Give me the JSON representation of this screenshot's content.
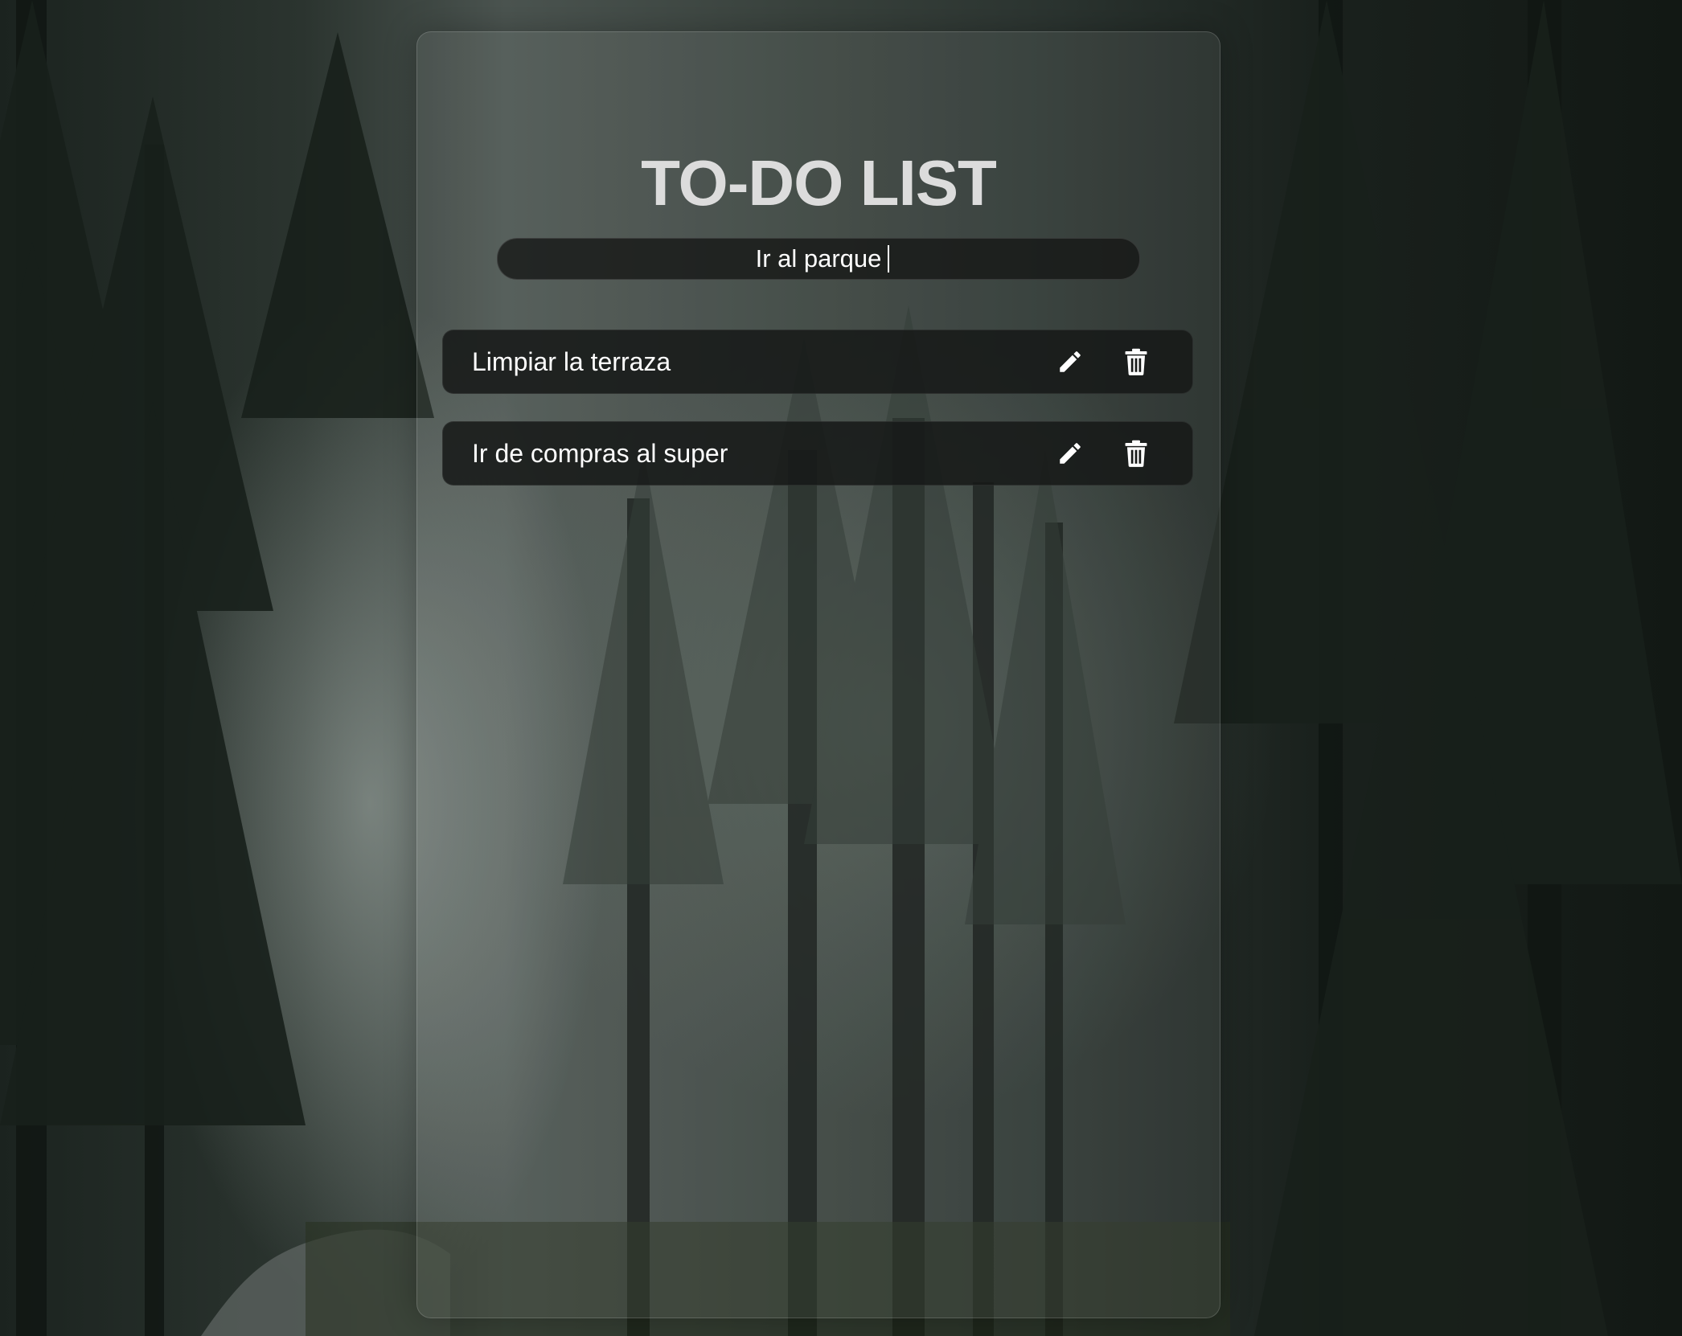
{
  "app": {
    "title": "TO-DO LIST"
  },
  "input": {
    "value": "Ir al parque"
  },
  "tasks": [
    {
      "text": "Limpiar la terraza",
      "edit_icon": "pencil-icon",
      "delete_icon": "trash-icon"
    },
    {
      "text": "Ir de compras al super",
      "edit_icon": "pencil-icon",
      "delete_icon": "trash-icon"
    }
  ],
  "colors": {
    "panel": "#ffffff12",
    "item_background": "#161817",
    "text": "#ffffff",
    "title": "#dcdcdc"
  }
}
